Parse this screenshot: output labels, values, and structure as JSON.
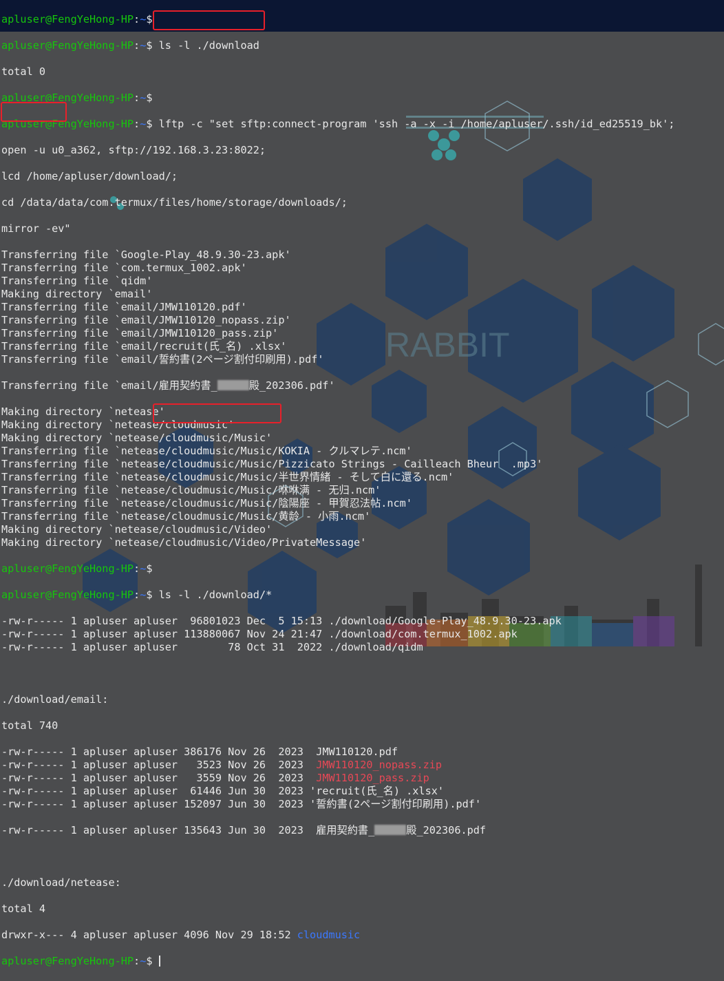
{
  "prompt": {
    "user_host": "apluser@FengYeHong-HP",
    "sep": ":",
    "path": "~",
    "dollar": "$"
  },
  "commands": {
    "ls1": " ls -l ./download",
    "lftp1": " lftp -c \"set sftp:connect-program 'ssh -a -x -i /home/apluser/.ssh/id_ed25519_bk';",
    "lftp2": "open -u u0_a362, sftp://192.168.3.23:8022;",
    "lftp3": "lcd /home/apluser/download/;",
    "lftp4": "cd /data/data/com.termux/files/home/storage/downloads/;",
    "lftp5": "mirror -ev\"",
    "ls2": " ls -l ./download/*"
  },
  "output": {
    "total0": "total 0",
    "transfer": [
      "Transferring file `Google-Play_48.9.30-23.apk'",
      "Transferring file `com.termux_1002.apk'",
      "Transferring file `qidm'",
      "Making directory `email'",
      "Transferring file `email/JMW110120.pdf'",
      "Transferring file `email/JMW110120_nopass.zip'",
      "Transferring file `email/JMW110120_pass.zip'",
      "Transferring file `email/recruit(氏_名) .xlsx'",
      "Transferring file `email/誓約書(2ページ割付印刷用).pdf'"
    ],
    "transfer_blur_a": "Transferring file `email/雇用契約書_",
    "transfer_blur_b": "殿_202306.pdf'",
    "transfer2": [
      "Making directory `netease'",
      "Making directory `netease/cloudmusic'",
      "Making directory `netease/cloudmusic/Music'",
      "Transferring file `netease/cloudmusic/Music/KOKIA - クルマレテ.ncm'",
      "Transferring file `netease/cloudmusic/Music/Pizzicato Strings - Cailleach Bheur  .mp3'",
      "Transferring file `netease/cloudmusic/Music/半世界情緒 - そして白に還る.ncm'",
      "Transferring file `netease/cloudmusic/Music/咻咻满 - 无归.ncm'",
      "Transferring file `netease/cloudmusic/Music/陰陽座 - 甲賀忍法帖.ncm'",
      "Transferring file `netease/cloudmusic/Music/黄龄 - 小雨.ncm'",
      "Making directory `netease/cloudmusic/Video'",
      "Making directory `netease/cloudmusic/Video/PrivateMessage'"
    ],
    "ls_files": [
      "-rw-r----- 1 apluser apluser  96801023 Dec  5 15:13 ./download/Google-Play_48.9.30-23.apk",
      "-rw-r----- 1 apluser apluser 113880067 Nov 24 21:47 ./download/com.termux_1002.apk",
      "-rw-r----- 1 apluser apluser        78 Oct 31  2022 ./download/qidm"
    ],
    "email_header": "./download/email:",
    "email_total": "total 740",
    "email_rows": [
      {
        "meta": "-rw-r----- 1 apluser apluser 386176 Nov 26  2023  ",
        "name": "JMW110120.pdf",
        "color": "plain"
      },
      {
        "meta": "-rw-r----- 1 apluser apluser   3523 Nov 26  2023  ",
        "name": "JMW110120_nopass.zip",
        "color": "red"
      },
      {
        "meta": "-rw-r----- 1 apluser apluser   3559 Nov 26  2023  ",
        "name": "JMW110120_pass.zip",
        "color": "red"
      },
      {
        "meta": "-rw-r----- 1 apluser apluser  61446 Jun 30  2023 ",
        "name": "'recruit(氏_名) .xlsx'",
        "color": "plain"
      },
      {
        "meta": "-rw-r----- 1 apluser apluser 152097 Jun 30  2023 ",
        "name": "'誓約書(2ページ割付印刷用).pdf'",
        "color": "plain"
      }
    ],
    "email_last_meta": "-rw-r----- 1 apluser apluser 135643 Jun 30  2023  雇用契約書_",
    "email_last_tail": "殿_202306.pdf",
    "netease_header": "./download/netease:",
    "netease_total": "total 4",
    "netease_meta": "drwxr-x--- 4 apluser apluser 4096 Nov 29 18:52 ",
    "netease_dir": "cloudmusic"
  },
  "colors": {
    "user": "#16c60c",
    "path": "#3b78ff",
    "red": "#e74856",
    "highlight": "#e8202a",
    "bg_top": "#0b1633",
    "bg": "#4b4c4e"
  },
  "wallpaper": {
    "text": "RABBIT"
  }
}
